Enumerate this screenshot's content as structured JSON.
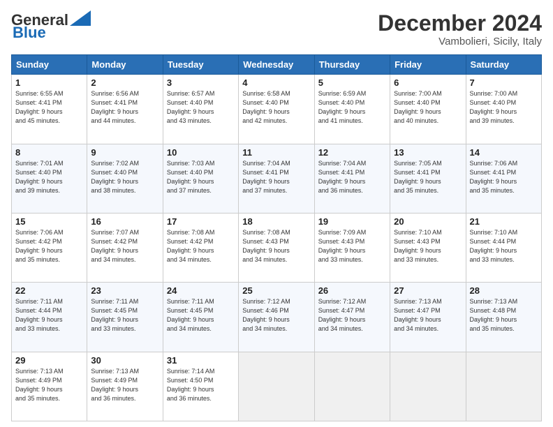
{
  "header": {
    "logo_line1": "General",
    "logo_line2": "Blue",
    "main_title": "December 2024",
    "subtitle": "Vambolieri, Sicily, Italy"
  },
  "calendar": {
    "headers": [
      "Sunday",
      "Monday",
      "Tuesday",
      "Wednesday",
      "Thursday",
      "Friday",
      "Saturday"
    ],
    "rows": [
      [
        {
          "day": "1",
          "info": "Sunrise: 6:55 AM\nSunset: 4:41 PM\nDaylight: 9 hours\nand 45 minutes."
        },
        {
          "day": "2",
          "info": "Sunrise: 6:56 AM\nSunset: 4:41 PM\nDaylight: 9 hours\nand 44 minutes."
        },
        {
          "day": "3",
          "info": "Sunrise: 6:57 AM\nSunset: 4:40 PM\nDaylight: 9 hours\nand 43 minutes."
        },
        {
          "day": "4",
          "info": "Sunrise: 6:58 AM\nSunset: 4:40 PM\nDaylight: 9 hours\nand 42 minutes."
        },
        {
          "day": "5",
          "info": "Sunrise: 6:59 AM\nSunset: 4:40 PM\nDaylight: 9 hours\nand 41 minutes."
        },
        {
          "day": "6",
          "info": "Sunrise: 7:00 AM\nSunset: 4:40 PM\nDaylight: 9 hours\nand 40 minutes."
        },
        {
          "day": "7",
          "info": "Sunrise: 7:00 AM\nSunset: 4:40 PM\nDaylight: 9 hours\nand 39 minutes."
        }
      ],
      [
        {
          "day": "8",
          "info": "Sunrise: 7:01 AM\nSunset: 4:40 PM\nDaylight: 9 hours\nand 39 minutes."
        },
        {
          "day": "9",
          "info": "Sunrise: 7:02 AM\nSunset: 4:40 PM\nDaylight: 9 hours\nand 38 minutes."
        },
        {
          "day": "10",
          "info": "Sunrise: 7:03 AM\nSunset: 4:40 PM\nDaylight: 9 hours\nand 37 minutes."
        },
        {
          "day": "11",
          "info": "Sunrise: 7:04 AM\nSunset: 4:41 PM\nDaylight: 9 hours\nand 37 minutes."
        },
        {
          "day": "12",
          "info": "Sunrise: 7:04 AM\nSunset: 4:41 PM\nDaylight: 9 hours\nand 36 minutes."
        },
        {
          "day": "13",
          "info": "Sunrise: 7:05 AM\nSunset: 4:41 PM\nDaylight: 9 hours\nand 35 minutes."
        },
        {
          "day": "14",
          "info": "Sunrise: 7:06 AM\nSunset: 4:41 PM\nDaylight: 9 hours\nand 35 minutes."
        }
      ],
      [
        {
          "day": "15",
          "info": "Sunrise: 7:06 AM\nSunset: 4:42 PM\nDaylight: 9 hours\nand 35 minutes."
        },
        {
          "day": "16",
          "info": "Sunrise: 7:07 AM\nSunset: 4:42 PM\nDaylight: 9 hours\nand 34 minutes."
        },
        {
          "day": "17",
          "info": "Sunrise: 7:08 AM\nSunset: 4:42 PM\nDaylight: 9 hours\nand 34 minutes."
        },
        {
          "day": "18",
          "info": "Sunrise: 7:08 AM\nSunset: 4:43 PM\nDaylight: 9 hours\nand 34 minutes."
        },
        {
          "day": "19",
          "info": "Sunrise: 7:09 AM\nSunset: 4:43 PM\nDaylight: 9 hours\nand 33 minutes."
        },
        {
          "day": "20",
          "info": "Sunrise: 7:10 AM\nSunset: 4:43 PM\nDaylight: 9 hours\nand 33 minutes."
        },
        {
          "day": "21",
          "info": "Sunrise: 7:10 AM\nSunset: 4:44 PM\nDaylight: 9 hours\nand 33 minutes."
        }
      ],
      [
        {
          "day": "22",
          "info": "Sunrise: 7:11 AM\nSunset: 4:44 PM\nDaylight: 9 hours\nand 33 minutes."
        },
        {
          "day": "23",
          "info": "Sunrise: 7:11 AM\nSunset: 4:45 PM\nDaylight: 9 hours\nand 33 minutes."
        },
        {
          "day": "24",
          "info": "Sunrise: 7:11 AM\nSunset: 4:45 PM\nDaylight: 9 hours\nand 34 minutes."
        },
        {
          "day": "25",
          "info": "Sunrise: 7:12 AM\nSunset: 4:46 PM\nDaylight: 9 hours\nand 34 minutes."
        },
        {
          "day": "26",
          "info": "Sunrise: 7:12 AM\nSunset: 4:47 PM\nDaylight: 9 hours\nand 34 minutes."
        },
        {
          "day": "27",
          "info": "Sunrise: 7:13 AM\nSunset: 4:47 PM\nDaylight: 9 hours\nand 34 minutes."
        },
        {
          "day": "28",
          "info": "Sunrise: 7:13 AM\nSunset: 4:48 PM\nDaylight: 9 hours\nand 35 minutes."
        }
      ],
      [
        {
          "day": "29",
          "info": "Sunrise: 7:13 AM\nSunset: 4:49 PM\nDaylight: 9 hours\nand 35 minutes."
        },
        {
          "day": "30",
          "info": "Sunrise: 7:13 AM\nSunset: 4:49 PM\nDaylight: 9 hours\nand 36 minutes."
        },
        {
          "day": "31",
          "info": "Sunrise: 7:14 AM\nSunset: 4:50 PM\nDaylight: 9 hours\nand 36 minutes."
        },
        {
          "day": "",
          "info": ""
        },
        {
          "day": "",
          "info": ""
        },
        {
          "day": "",
          "info": ""
        },
        {
          "day": "",
          "info": ""
        }
      ]
    ]
  }
}
